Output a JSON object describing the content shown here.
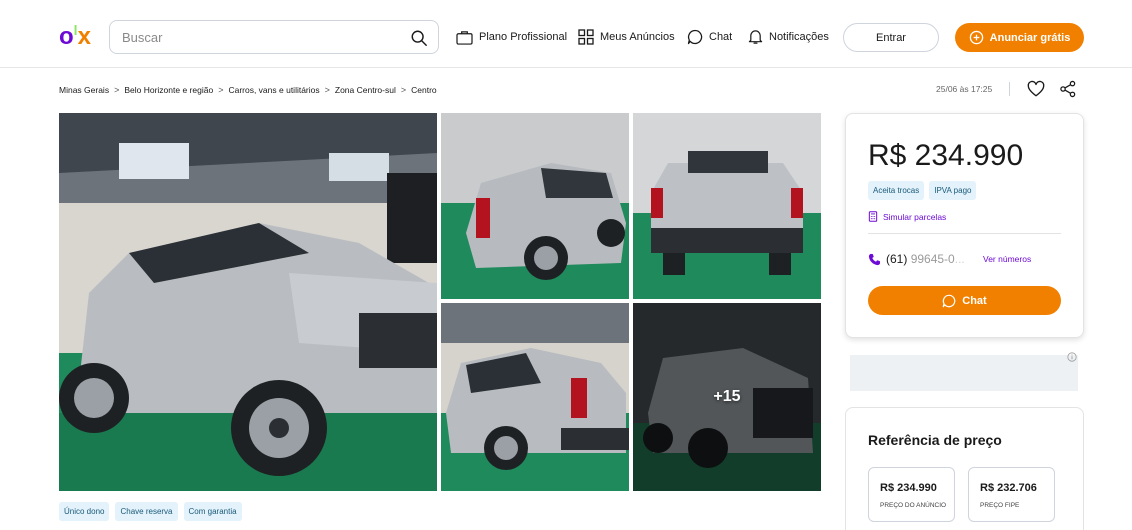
{
  "header": {
    "logo": "olx",
    "search_placeholder": "Buscar",
    "nav": {
      "plano": "Plano Profissional",
      "anuncios": "Meus Anúncios",
      "chat": "Chat",
      "notificacoes": "Notificações"
    },
    "entrar_label": "Entrar",
    "anunciar_label": "Anunciar grátis"
  },
  "breadcrumb": {
    "items": [
      "Minas Gerais",
      "Belo Horizonte e região",
      "Carros, vans e utilitários",
      "Zona Centro-sul",
      "Centro"
    ],
    "separator": ">"
  },
  "listing": {
    "date": "25/06 às 17:25",
    "photo_count_label": "+15",
    "tags": [
      "Único dono",
      "Chave reserva",
      "Com garantia"
    ]
  },
  "price_card": {
    "price": "R$ 234.990",
    "badges": [
      "Aceita trocas",
      "IPVA pago"
    ],
    "simular_label": "Simular parcelas",
    "phone_prefix": "(61)",
    "phone_masked": "99645-0",
    "phone_fade": "...",
    "ver_numeros_label": "Ver números",
    "chat_label": "Chat"
  },
  "reference": {
    "title": "Referência de preço",
    "items": [
      {
        "value": "R$ 234.990",
        "label": "PREÇO DO ANÚNCIO"
      },
      {
        "value": "R$ 232.706",
        "label": "PREÇO FIPE"
      }
    ]
  },
  "colors": {
    "brand_purple": "#6e0ad6",
    "brand_orange": "#f28000",
    "brand_green": "#8ce563",
    "tag_bg": "#e3f2fb"
  },
  "icons": [
    "search-icon",
    "briefcase-icon",
    "grid-icon",
    "chat-icon",
    "bell-icon",
    "plus-circle-icon",
    "heart-icon",
    "share-icon",
    "calculator-icon",
    "phone-icon",
    "info-icon"
  ]
}
